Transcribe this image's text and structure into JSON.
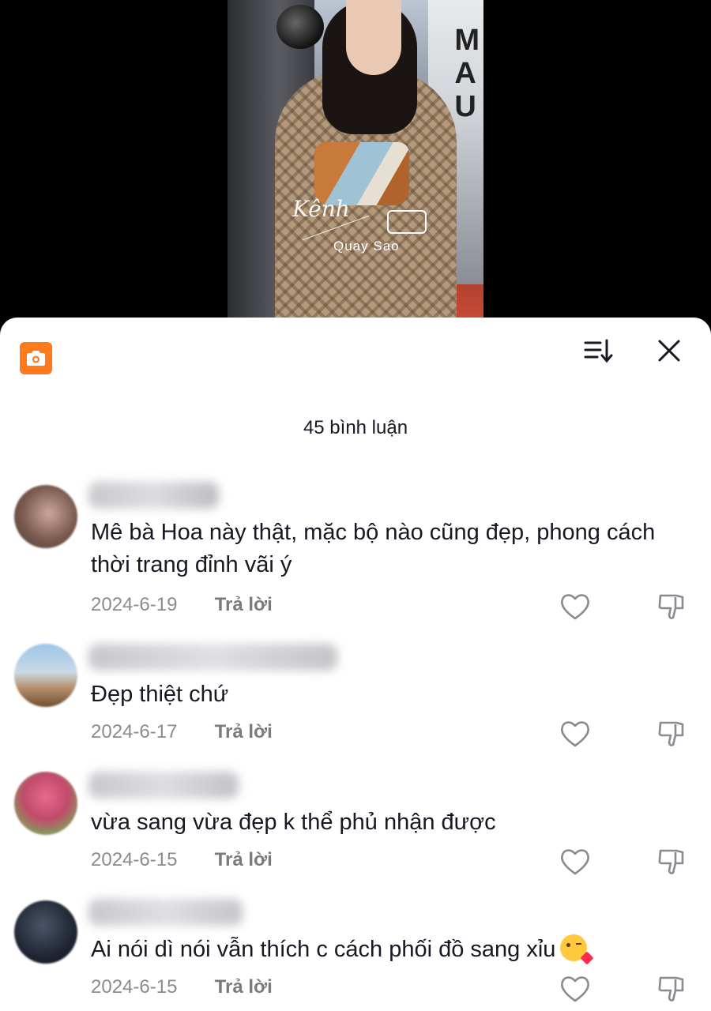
{
  "video": {
    "watermark_script": "Kênh",
    "watermark_sub": "Quay Sao"
  },
  "header": {
    "comment_count_label": "45 bình luận",
    "icons": {
      "camera": "camera-icon",
      "sort": "sort-icon",
      "close": "close-icon"
    },
    "accent_color": "#ff7a1a"
  },
  "comments": [
    {
      "text": "Mê bà Hoa này thật, mặc bộ nào cũng đẹp, phong cách thời trang đỉnh vãi ý",
      "date": "2024-6-19",
      "reply_label": "Trả lời"
    },
    {
      "text": "Đẹp thiệt chứ",
      "date": "2024-6-17",
      "reply_label": "Trả lời"
    },
    {
      "text": "vừa sang vừa đẹp k thể phủ nhận được",
      "date": "2024-6-15",
      "reply_label": "Trả lời"
    },
    {
      "text": "Ai nói dì nói vẫn thích c cách phối đồ sang xỉu",
      "emoji": "kissing-face-emoji",
      "date": "2024-6-15",
      "reply_label": "Trả lời"
    }
  ]
}
